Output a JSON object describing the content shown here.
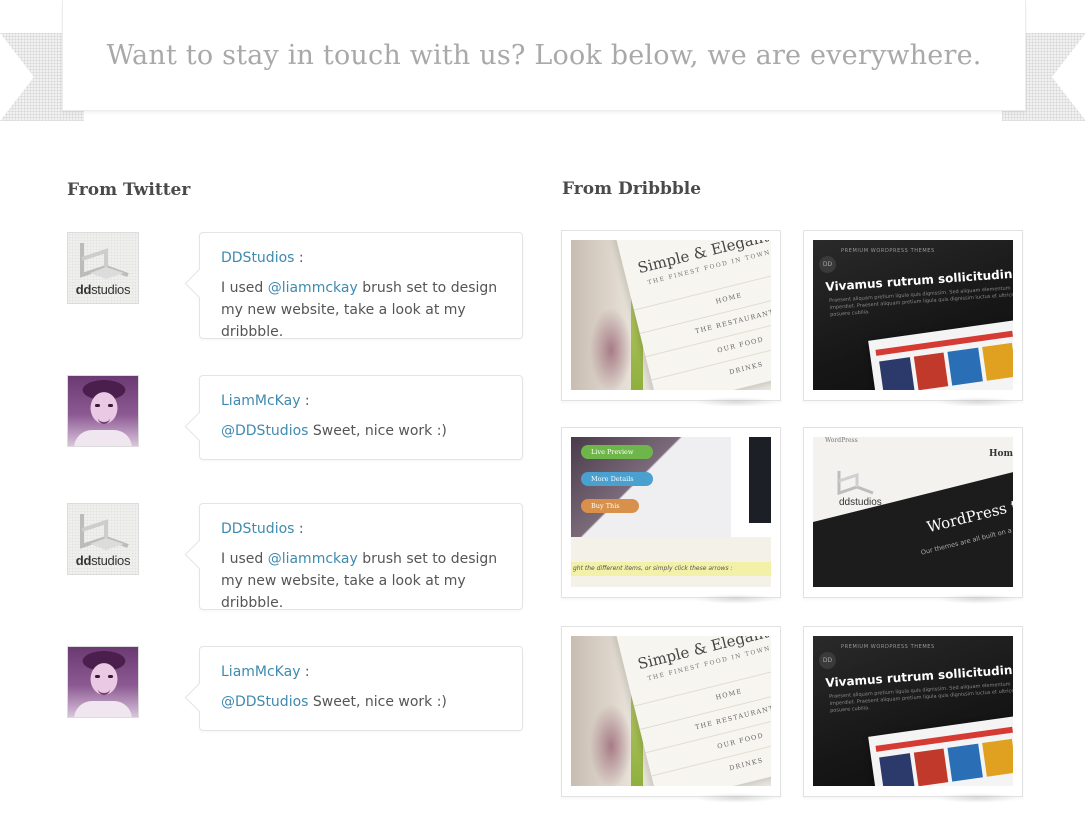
{
  "banner": {
    "text": "Want to stay in touch with us? Look below, we are everywhere."
  },
  "twitter": {
    "title": "From Twitter",
    "tweets": [
      {
        "avatar": "ddstudios-logo",
        "author": "DDStudios",
        "separator": " :",
        "before": "I used ",
        "mention": "@liammckay",
        "after": " brush set to design my new website, take a look at my dribbble."
      },
      {
        "avatar": "liammckay-photo",
        "author": "LiamMcKay",
        "separator": " :",
        "before": "",
        "mention": "@DDStudios",
        "after": " Sweet, nice work :)"
      },
      {
        "avatar": "ddstudios-logo",
        "author": "DDStudios",
        "separator": " :",
        "before": "I used ",
        "mention": "@liammckay",
        "after": " brush set to design my new website, take a look at my dribbble."
      },
      {
        "avatar": "liammckay-photo",
        "author": "LiamMcKay",
        "separator": " :",
        "before": "",
        "mention": "@DDStudios",
        "after": " Sweet, nice work :)"
      }
    ],
    "logo_word_bold": "dd",
    "logo_word_rest": "studios"
  },
  "dribbble": {
    "title": "From Dribbble",
    "shots": {
      "simple_elegant": {
        "title": "Simple & Elegant",
        "tagline": "THE FINEST FOOD IN TOWN",
        "menu": [
          "HOME",
          "THE RESTAURANT",
          "OUR FOOD",
          "DRINKS"
        ]
      },
      "dark_theme": {
        "badge": "DD",
        "kicker": "PREMIUM WORDPRESS THEMES",
        "headline": "Vivamus rutrum sollicitudin nisi qui",
        "lorem": "Praesent aliquam pretium ligula quis dignissim. Sed aliquam elementum imperdiet. Praesent aliquam pretium ligula quis dignissim luctus et ultrices posuere cubilia."
      },
      "buttons": {
        "live_preview": "Live Preview",
        "more_details": "More Details",
        "buy_this": "Buy This",
        "hint": "ght the different items, or simply click these arrows :"
      },
      "ddstudios_wp": {
        "label": "WordPress",
        "home": "Hom",
        "logo_word": "ddstudios",
        "title": "WordPress th",
        "subtitle": "Our themes are all built on a sol"
      }
    }
  },
  "colors": {
    "link": "#3f8ab0",
    "heading": "#4a4a4a",
    "banner_text": "#a9a9a9",
    "green_button": "#6fb64a",
    "blue_button": "#4aa0cf",
    "orange_button": "#d9904a"
  }
}
